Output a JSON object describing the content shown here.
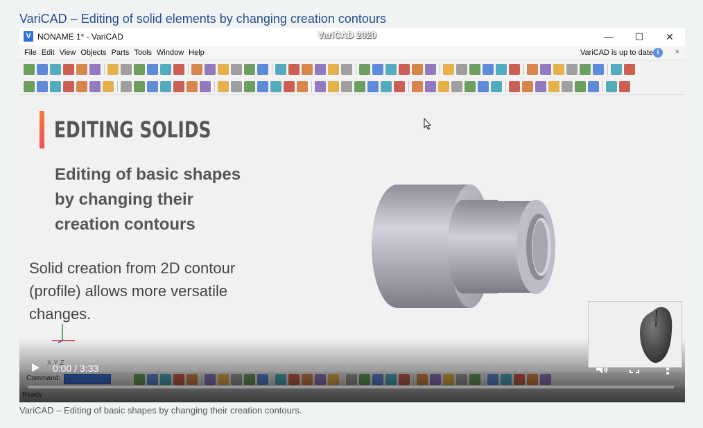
{
  "page": {
    "title": "VariCAD – Editing of solid elements by changing creation contours",
    "caption": "VariCAD – Editing of basic shapes by changing their creation contours."
  },
  "window": {
    "logo_letter": "V",
    "title": "NONAME 1* - VariCAD",
    "center_title": "VariCAD 2020",
    "minimize": "—",
    "maximize": "☐",
    "close": "✕"
  },
  "menu": {
    "items": [
      "File",
      "Edit",
      "View",
      "Objects",
      "Parts",
      "Tools",
      "Window",
      "Help"
    ],
    "update_status": "VariCAD is up to date",
    "info_glyph": "i",
    "close_glyph": "×"
  },
  "slide": {
    "heading": "EDITING SOLIDS",
    "subtitle_lines": [
      "Editing of basic shapes",
      "by changing their",
      "creation contours"
    ],
    "body_lines": [
      "Solid creation from 2D contour",
      "(profile) allows more versatile",
      "changes."
    ]
  },
  "bottom_bar": {
    "command_label": "Command:",
    "status_text": "Ready",
    "axis_label": "X Y Z"
  },
  "video": {
    "current_time": "0:00",
    "duration": "3:33",
    "time_display": "0:00 / 3:33",
    "progress_fraction": 0.0
  },
  "icons": {
    "play": "play-icon",
    "volume": "volume-icon",
    "fullscreen": "fullscreen-icon",
    "more": "more-vert-icon",
    "accent": "#ee4f5c"
  }
}
